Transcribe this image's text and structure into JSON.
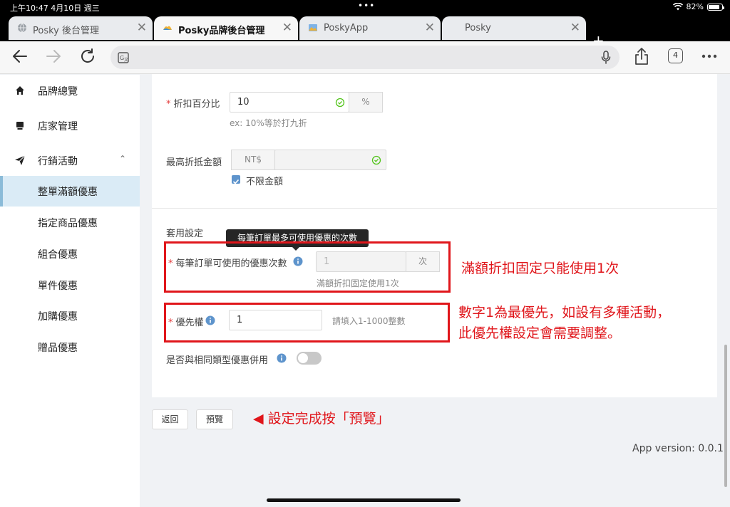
{
  "status": {
    "time": "上午10:47  4月10日 週三",
    "battery": "82%",
    "battery_level": 0.82
  },
  "tabs": [
    {
      "label": "Posky 後台管理",
      "close": "✕"
    },
    {
      "label": "Posky品牌後台管理",
      "close": "✕"
    },
    {
      "label": "PoskyApp",
      "close": "✕"
    },
    {
      "label": "Posky",
      "close": "✕"
    }
  ],
  "toolbar": {
    "tab_count": "4",
    "new_tab": "+"
  },
  "sidebar": {
    "items": [
      {
        "label": "品牌總覽",
        "icon": "home-icon"
      },
      {
        "label": "店家管理",
        "icon": "store-icon"
      },
      {
        "label": "行銷活動",
        "icon": "send-icon",
        "chevron": "⌃"
      }
    ],
    "sub_items": [
      {
        "label": "整單滿額優惠",
        "active": true
      },
      {
        "label": "指定商品優惠"
      },
      {
        "label": "組合優惠"
      },
      {
        "label": "單件優惠"
      },
      {
        "label": "加購優惠"
      },
      {
        "label": "贈品優惠"
      }
    ]
  },
  "form": {
    "discount_percent": {
      "label": "折扣百分比",
      "value": "10",
      "suffix": "%",
      "hint": "ex: 10%等於打九折"
    },
    "max_discount": {
      "label": "最高折抵金額",
      "prefix": "NT$",
      "value": "",
      "unlimited_label": "不限金額",
      "unlimited_checked": true
    },
    "apply_settings": {
      "title": "套用設定"
    },
    "usage_count": {
      "label": "每筆訂單可使用的優惠次數",
      "value": "1",
      "suffix": "次",
      "hint": "滿額折扣固定使用1次",
      "tooltip": "每筆訂單最多可使用優惠的次數"
    },
    "priority": {
      "label": "優先權",
      "value": "1",
      "hint": "請填入1-1000整數"
    },
    "combine": {
      "label": "是否與相同類型優惠併用",
      "enabled": false
    }
  },
  "buttons": {
    "back": "返回",
    "preview": "預覽"
  },
  "annotations": {
    "usage": "滿額折扣固定只能使用1次",
    "priority_line1": "數字1為最優先，如設有多種活動，",
    "priority_line2": "此優先權設定會需要調整。",
    "preview": "◀  設定完成按「預覽」"
  },
  "app_version": "App version: 0.0.1",
  "colors": {
    "annotation_red": "#e0161b",
    "active_menu_bg": "#daebf6",
    "check_green": "#52c41a",
    "info_blue": "#5e94cc"
  }
}
